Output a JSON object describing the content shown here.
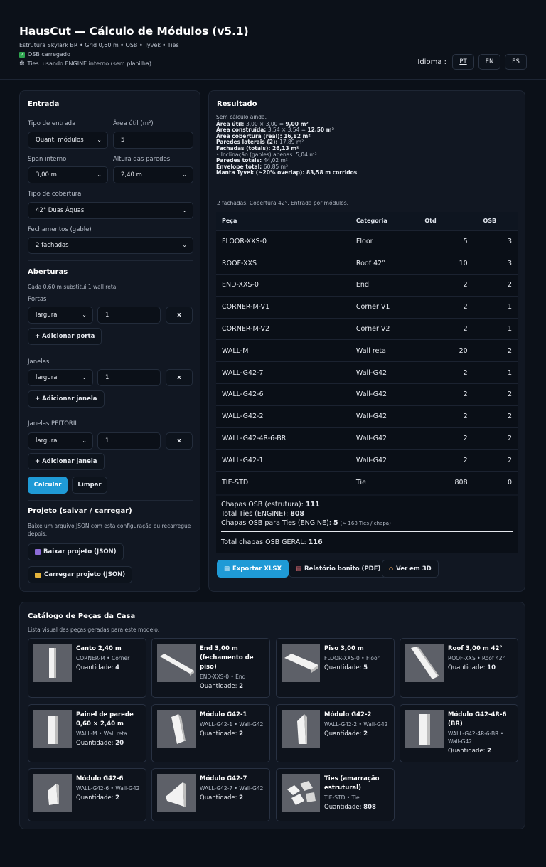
{
  "header": {
    "title": "HausCut — Cálculo de Módulos (v5.1)",
    "subtitle": "Estrutura Skylark BR • Grid 0,60 m • OSB • Tyvek • Ties",
    "status_osb": "OSB carregado",
    "status_ties": "Ties: usando ENGINE interno (sem planilha)",
    "lang_label": "Idioma :",
    "langs": [
      "PT",
      "EN",
      "ES"
    ]
  },
  "entrada": {
    "title": "Entrada",
    "tipo_entrada_label": "Tipo de entrada",
    "tipo_entrada_value": "Quant. módulos",
    "area_util_label": "Área útil (m²)",
    "area_util_value": "5",
    "span_label": "Span interno",
    "span_value": "3,00 m",
    "altura_label": "Altura das paredes",
    "altura_value": "2,40 m",
    "cobertura_label": "Tipo de cobertura",
    "cobertura_value": "42° Duas Águas",
    "fechamentos_label": "Fechamentos (gable)",
    "fechamentos_value": "2 fachadas"
  },
  "aberturas": {
    "title": "Aberturas",
    "note": "Cada 0,60 m substitui 1 wall reta.",
    "portas_label": "Portas",
    "janelas_label": "Janelas",
    "peitoril_label": "Janelas PEITORIL",
    "dim_value": "largura",
    "qty_value": "1",
    "x_label": "x",
    "add_porta": "+ Adicionar porta",
    "add_janela": "+ Adicionar janela",
    "calcular": "Calcular",
    "limpar": "Limpar"
  },
  "projeto": {
    "title": "Projeto (salvar / carregar)",
    "note": "Baixe um arquivo JSON com esta configuração ou recarregue depois.",
    "baixar": "Baixar projeto (JSON)",
    "carregar": "Carregar projeto (JSON)"
  },
  "resultado": {
    "title": "Resultado",
    "lines": [
      {
        "k": "",
        "v": "Sem cálculo ainda."
      },
      {
        "k": "Área útil:",
        "v": "3,00 × 3,00 = ",
        "b": "9,00 m²"
      },
      {
        "k": "Área construída:",
        "v": "3,54 × 3,54 = ",
        "b": "12,50 m²"
      },
      {
        "k": "Área cobertura (real):",
        "v": "",
        "b": "16,82 m²"
      },
      {
        "k": "Paredes laterais (2):",
        "v": "17,89 m²",
        "b": ""
      },
      {
        "k": "Fachadas (totais):",
        "v": "",
        "b": "26,13 m²"
      },
      {
        "k": "",
        "v": "• Inclinação (gables) apenas: 5,04 m²"
      },
      {
        "k": "Paredes totais:",
        "v": "44,02 m²",
        "b": ""
      },
      {
        "k": "Envelope total:",
        "v": "60,85 m²",
        "b": ""
      },
      {
        "k": "Manta Tyvek (~20% overlap):",
        "v": "",
        "b": "83,58 m corridos"
      }
    ],
    "footnote": "2 fachadas. Cobertura 42°. Entrada por módulos.",
    "columns": [
      "Peça",
      "Categoria",
      "Qtd",
      "OSB"
    ],
    "rows": [
      [
        "FLOOR-XXS-0",
        "Floor",
        "5",
        "3"
      ],
      [
        "ROOF-XXS",
        "Roof 42°",
        "10",
        "3"
      ],
      [
        "END-XXS-0",
        "End",
        "2",
        "2"
      ],
      [
        "CORNER-M-V1",
        "Corner V1",
        "2",
        "1"
      ],
      [
        "CORNER-M-V2",
        "Corner V2",
        "2",
        "1"
      ],
      [
        "WALL-M",
        "Wall reta",
        "20",
        "2"
      ],
      [
        "WALL-G42-7",
        "Wall-G42",
        "2",
        "1"
      ],
      [
        "WALL-G42-6",
        "Wall-G42",
        "2",
        "2"
      ],
      [
        "WALL-G42-2",
        "Wall-G42",
        "2",
        "2"
      ],
      [
        "WALL-G42-4R-6-BR",
        "Wall-G42",
        "2",
        "2"
      ],
      [
        "WALL-G42-1",
        "Wall-G42",
        "2",
        "2"
      ],
      [
        "TIE-STD",
        "Tie",
        "808",
        "0"
      ]
    ],
    "tot_osb_label": "Chapas OSB (estrutura):",
    "tot_osb": "111",
    "tot_ties_label": "Total Ties (ENGINE):",
    "tot_ties": "808",
    "tot_osb_ties_label": "Chapas OSB para Ties (ENGINE):",
    "tot_osb_ties": "5",
    "tot_osb_ties_note": "(≈ 168 Ties / chapa)",
    "tot_geral_label": "Total chapas OSB GERAL:",
    "tot_geral": "116",
    "btn_xlsx": "Exportar XLSX",
    "btn_pdf": "Relatório bonito (PDF)",
    "btn_3d": "Ver em 3D"
  },
  "catalogo": {
    "title": "Catálogo de Peças da Casa",
    "subtitle": "Lista visual das peças geradas para este modelo.",
    "qty_label": "Quantidade:",
    "items": [
      {
        "name": "Canto 2,40 m",
        "meta": "CORNER-M • Corner",
        "qty": "4"
      },
      {
        "name": "End 3,00 m (fechamento de piso)",
        "meta": "END-XXS-0 • End",
        "qty": "2"
      },
      {
        "name": "Piso 3,00 m",
        "meta": "FLOOR-XXS-0 • Floor",
        "qty": "5"
      },
      {
        "name": "Roof 3,00 m 42°",
        "meta": "ROOF-XXS • Roof 42°",
        "qty": "10"
      },
      {
        "name": "Painel de parede 0,60 × 2,40 m",
        "meta": "WALL-M • Wall reta",
        "qty": "20"
      },
      {
        "name": "Módulo G42-1",
        "meta": "WALL-G42-1 • Wall-G42",
        "qty": "2"
      },
      {
        "name": "Módulo G42-2",
        "meta": "WALL-G42-2 • Wall-G42",
        "qty": "2"
      },
      {
        "name": "Módulo G42-4R-6 (BR)",
        "meta": "WALL-G42-4R-6-BR • Wall-G42",
        "qty": "2"
      },
      {
        "name": "Módulo G42-6",
        "meta": "WALL-G42-6 • Wall-G42",
        "qty": "2"
      },
      {
        "name": "Módulo G42-7",
        "meta": "WALL-G42-7 • Wall-G42",
        "qty": "2"
      },
      {
        "name": "Ties (amarração estrutural)",
        "meta": "TIE-STD • Tie",
        "qty": "808"
      }
    ]
  }
}
